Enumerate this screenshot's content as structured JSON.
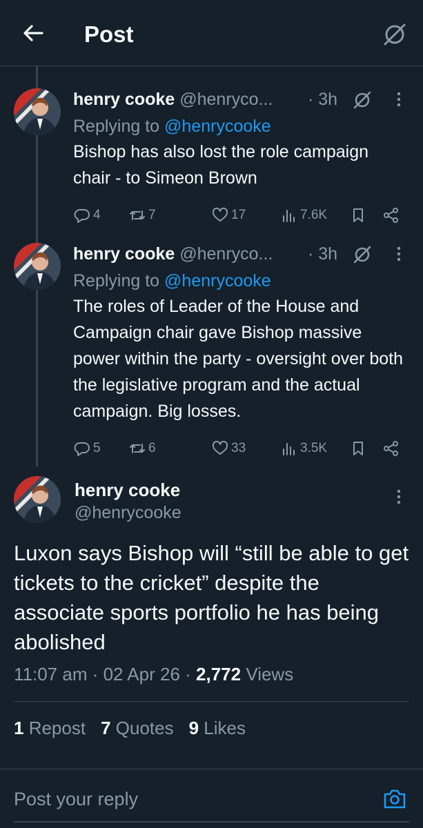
{
  "header": {
    "title": "Post",
    "back_icon": "arrow-left-icon",
    "right_icon": "grok-icon"
  },
  "replies": [
    {
      "name": "henry cooke",
      "handle": "@henryco...",
      "time": "· 3h",
      "replying_prefix": "Replying to ",
      "replying_to": "@henrycooke",
      "text": "Bishop has also lost the role campaign chair - to Simeon Brown",
      "stats": {
        "replies": "4",
        "reposts": "7",
        "likes": "17",
        "views": "7.6K"
      }
    },
    {
      "name": "henry cooke",
      "handle": "@henryco...",
      "time": "· 3h",
      "replying_prefix": "Replying to ",
      "replying_to": "@henrycooke",
      "text": "The roles of Leader of the House and Campaign chair gave Bishop massive power within the party - oversight over both the legislative program and the actual campaign. Big losses.",
      "stats": {
        "replies": "5",
        "reposts": "6",
        "likes": "33",
        "views": "3.5K"
      }
    }
  ],
  "main": {
    "name": "henry cooke",
    "handle": "@henrycooke",
    "text": "Luxon says Bishop will “still be able to get tickets to the cricket” despite the associate sports portfolio he has being abolished",
    "time": "11:07 am",
    "sep1": " · ",
    "date": "02 Apr 26",
    "sep2": " · ",
    "views": "2,772",
    "views_label": " Views",
    "reposts": "1",
    "reposts_label": " Repost",
    "quotes": "7",
    "quotes_label": " Quotes",
    "likes": "9",
    "likes_label": " Likes"
  },
  "compose": {
    "placeholder": "Post your reply",
    "icon": "camera-icon"
  },
  "colors": {
    "background": "#15202b",
    "accent": "#1d9bf0",
    "muted": "#8b98a5",
    "text": "#f7f9f9",
    "border": "#38444d"
  }
}
